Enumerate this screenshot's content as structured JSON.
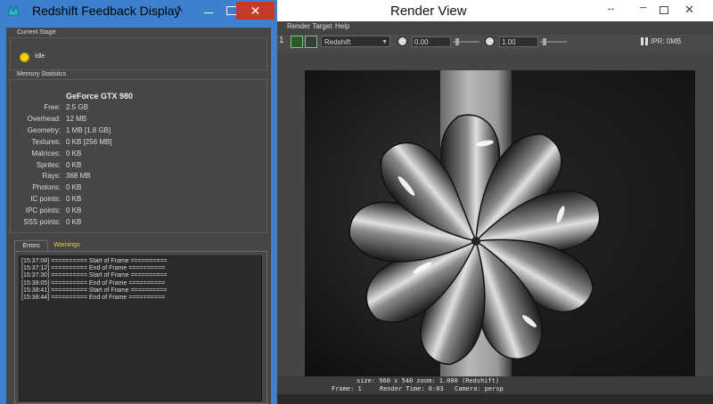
{
  "render_view": {
    "title": "Render View",
    "menu": {
      "render_target": "Render Target",
      "help": "Help"
    },
    "toolbar": {
      "renderer": "Redshift",
      "exposure": "0.00",
      "gamma": "1.00",
      "ipr": "IPR: 0MB"
    },
    "status": {
      "size_zoom": "size: 960 x 540  zoom: 1.000",
      "renderer": "(Redshift)",
      "frame": "Frame: 1",
      "render_time": "Render Time: 0:03",
      "camera": "Camera: persp"
    }
  },
  "feedback": {
    "title": "Redshift Feedback Display",
    "current_stage": {
      "heading": "Current Stage",
      "status": "Idle",
      "status_color": "#f2d100"
    },
    "memory": {
      "heading": "Memory Statistics",
      "gpu": "GeForce GTX 980",
      "rows": [
        {
          "label": "Free:",
          "value": "2.5 GB"
        },
        {
          "label": "Overhead:",
          "value": "12 MB"
        },
        {
          "label": "Geometry:",
          "value": "1 MB [1.8 GB]"
        },
        {
          "label": "Textures:",
          "value": "0 KB [256 MB]"
        },
        {
          "label": "Matrices:",
          "value": "0 KB"
        },
        {
          "label": "Sprites:",
          "value": "0 KB"
        },
        {
          "label": "Rays:",
          "value": "368 MB"
        },
        {
          "label": "Photons:",
          "value": "0 KB"
        },
        {
          "label": "IC points:",
          "value": "0 KB"
        },
        {
          "label": "IPC points:",
          "value": "0 KB"
        },
        {
          "label": "SSS points:",
          "value": "0 KB"
        }
      ]
    },
    "tabs": {
      "errors": "Errors",
      "warnings": "Warnings"
    },
    "log": [
      "[15:37:08] ========== Start of Frame ==========",
      "[15:37:12] ========== End of Frame ==========",
      "[15:37:30] ========== Start of Frame ==========",
      "[15:38:05] ========== End of Frame ==========",
      "[15:38:41] ========== Start of Frame ==========",
      "[15:38:44] ========== End of Frame =========="
    ]
  }
}
